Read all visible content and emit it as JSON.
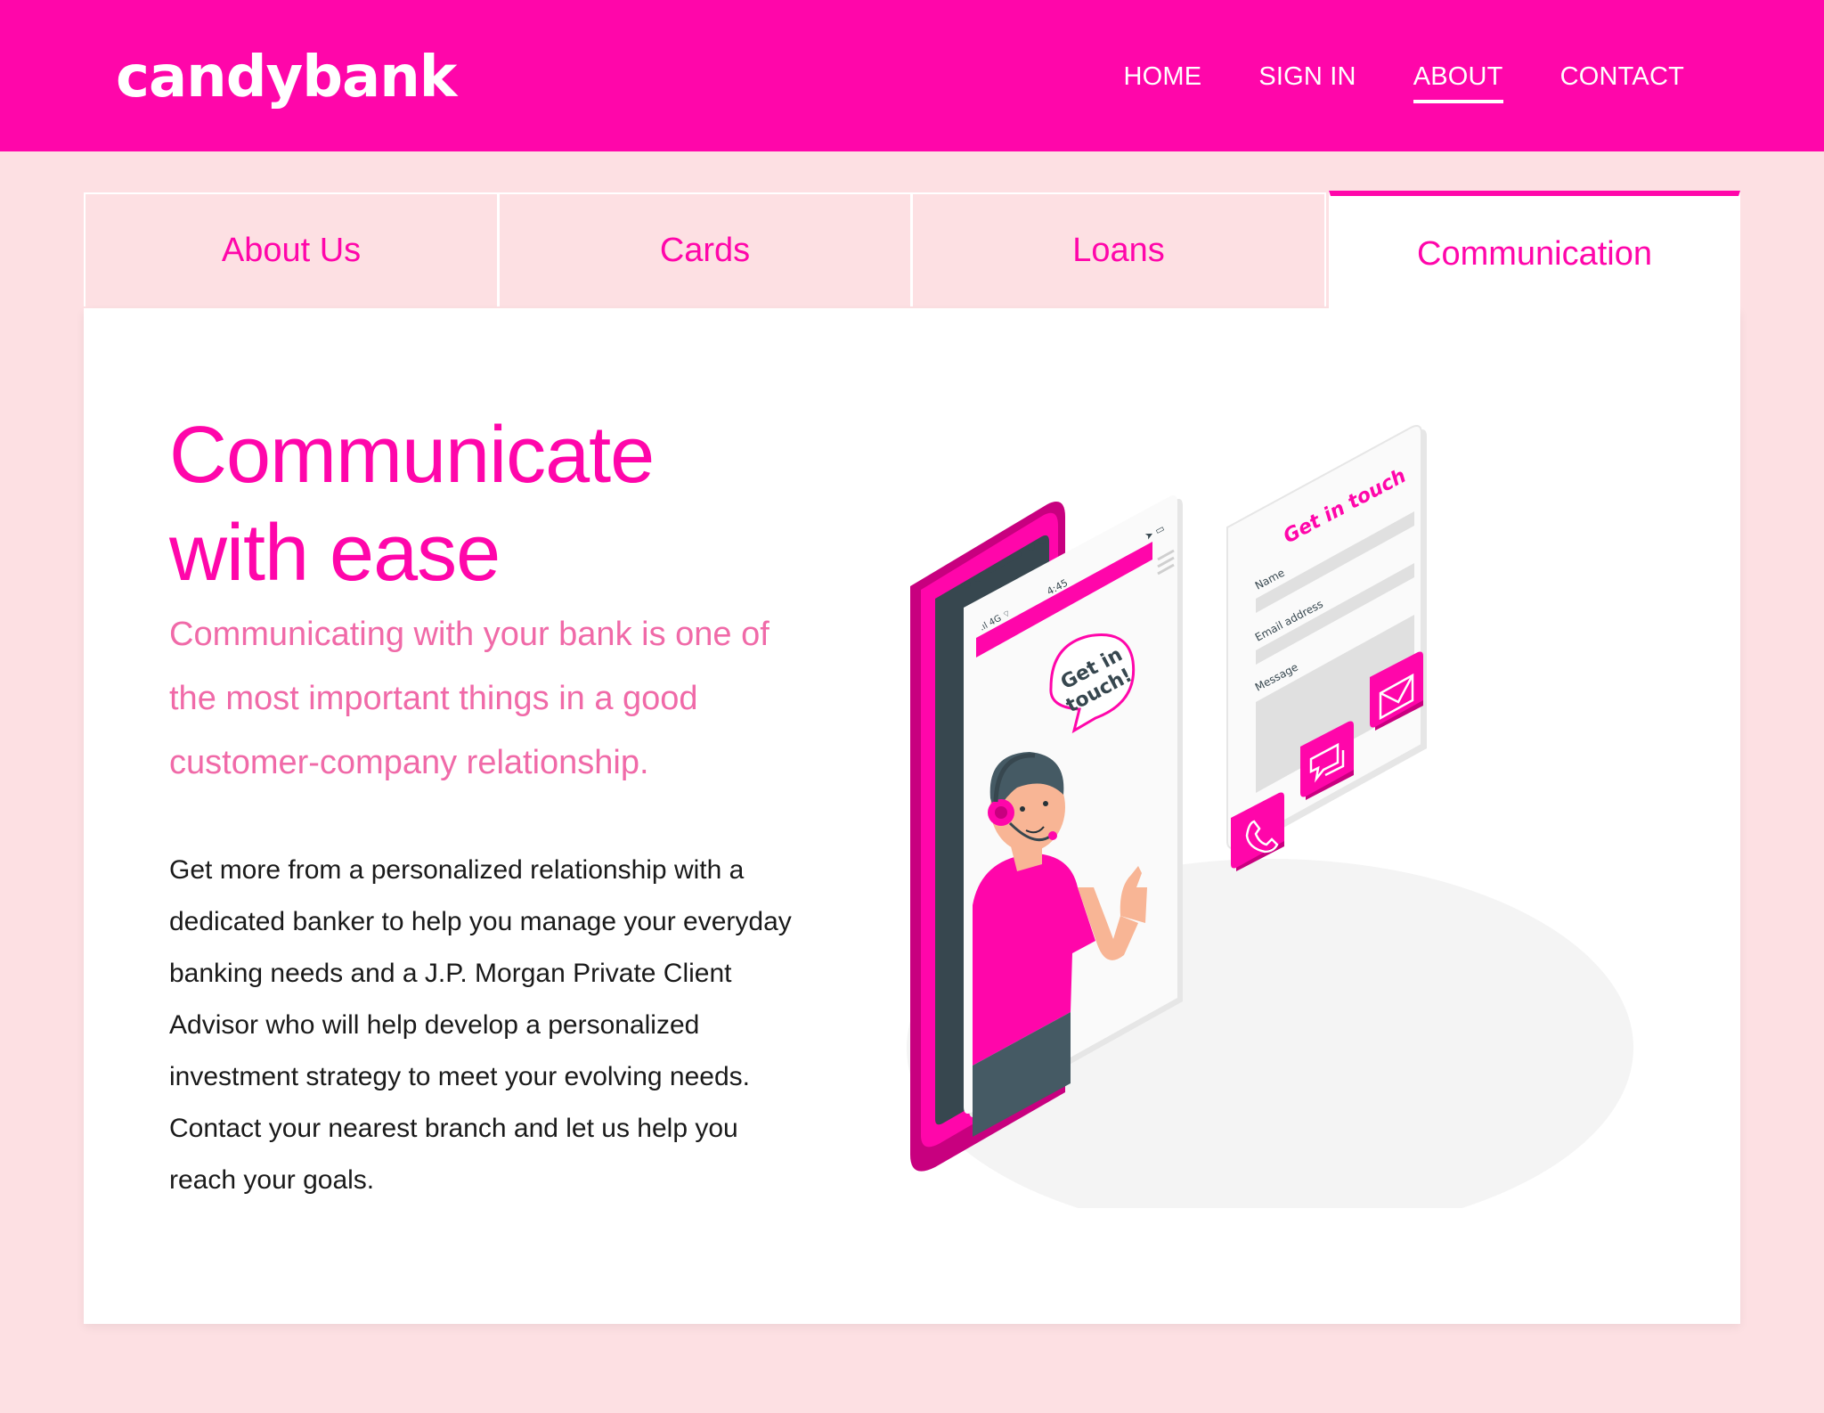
{
  "brand": {
    "name": "candybank",
    "primary": "#ff06aa",
    "background": "#fde0e3"
  },
  "nav": {
    "links": [
      {
        "label": "HOME",
        "active": false
      },
      {
        "label": "SIGN IN",
        "active": false
      },
      {
        "label": "ABOUT",
        "active": true
      },
      {
        "label": "CONTACT",
        "active": false
      }
    ]
  },
  "tabs": [
    {
      "label": "About Us",
      "active": false
    },
    {
      "label": "Cards",
      "active": false
    },
    {
      "label": "Loans",
      "active": false
    },
    {
      "label": "Communication",
      "active": true
    }
  ],
  "content": {
    "heading": "Communicate with ease",
    "lead": "Communicating with your bank is one of the most important things in a good customer-company relationship.",
    "body": "Get more from a personalized relationship with a dedicated banker to help you manage your everyday banking needs and a J.P. Morgan Private Client Advisor who will help develop a personalized investment strategy to meet your evolving needs. Contact your nearest branch and let us help you reach your goals."
  },
  "illustration": {
    "phone_time": "4:45",
    "phone_network": "4G",
    "speech_bubble": "Get in touch!",
    "form": {
      "title": "Get in touch",
      "fields": [
        "Name",
        "Email address",
        "Message"
      ]
    },
    "icons": [
      "phone-icon",
      "chat-icon",
      "mail-icon"
    ]
  }
}
